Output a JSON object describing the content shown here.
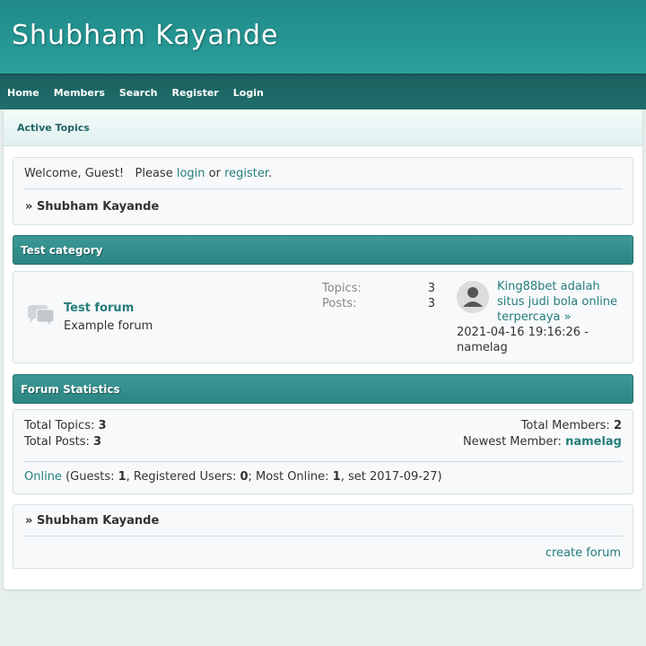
{
  "site": {
    "title": "Shubham Kayande"
  },
  "nav": {
    "items": [
      "Home",
      "Members",
      "Search",
      "Register",
      "Login"
    ]
  },
  "subnav": {
    "active_topics": "Active Topics"
  },
  "welcome": {
    "prefix": "Welcome, Guest!   Please ",
    "login": "login",
    "or": " or ",
    "register": "register",
    "suffix": "."
  },
  "breadcrumb": {
    "arrow": "»",
    "label": "Shubham Kayande"
  },
  "category": {
    "title": "Test category",
    "forum": {
      "name": "Test forum",
      "description": "Example forum",
      "topics_label": "Topics:",
      "topics": "3",
      "posts_label": "Posts:",
      "posts": "3",
      "last_post_title": "King88bet adalah situs judi bola online terpercaya",
      "last_post_arrow": "»",
      "last_post_meta": "2021-04-16 19:16:26 - namelag"
    }
  },
  "forum_statistics": {
    "title": "Forum Statistics",
    "total_topics_label": "Total Topics: ",
    "total_topics": "3",
    "total_posts_label": "Total Posts: ",
    "total_posts": "3",
    "total_members_label": "Total Members: ",
    "total_members": "2",
    "newest_member_label": "Newest Member: ",
    "newest_member": "namelag",
    "online_link": "Online",
    "guests_label": " (Guests: ",
    "guests": "1",
    "registered_label": ", Registered Users: ",
    "registered": "0",
    "most_online_label": "; Most Online: ",
    "most_online": "1",
    "most_online_date": ", set 2017-09-27)"
  },
  "footer": {
    "breadcrumb_arrow": "»",
    "breadcrumb_label": "Shubham Kayande",
    "create_forum": "create forum"
  }
}
